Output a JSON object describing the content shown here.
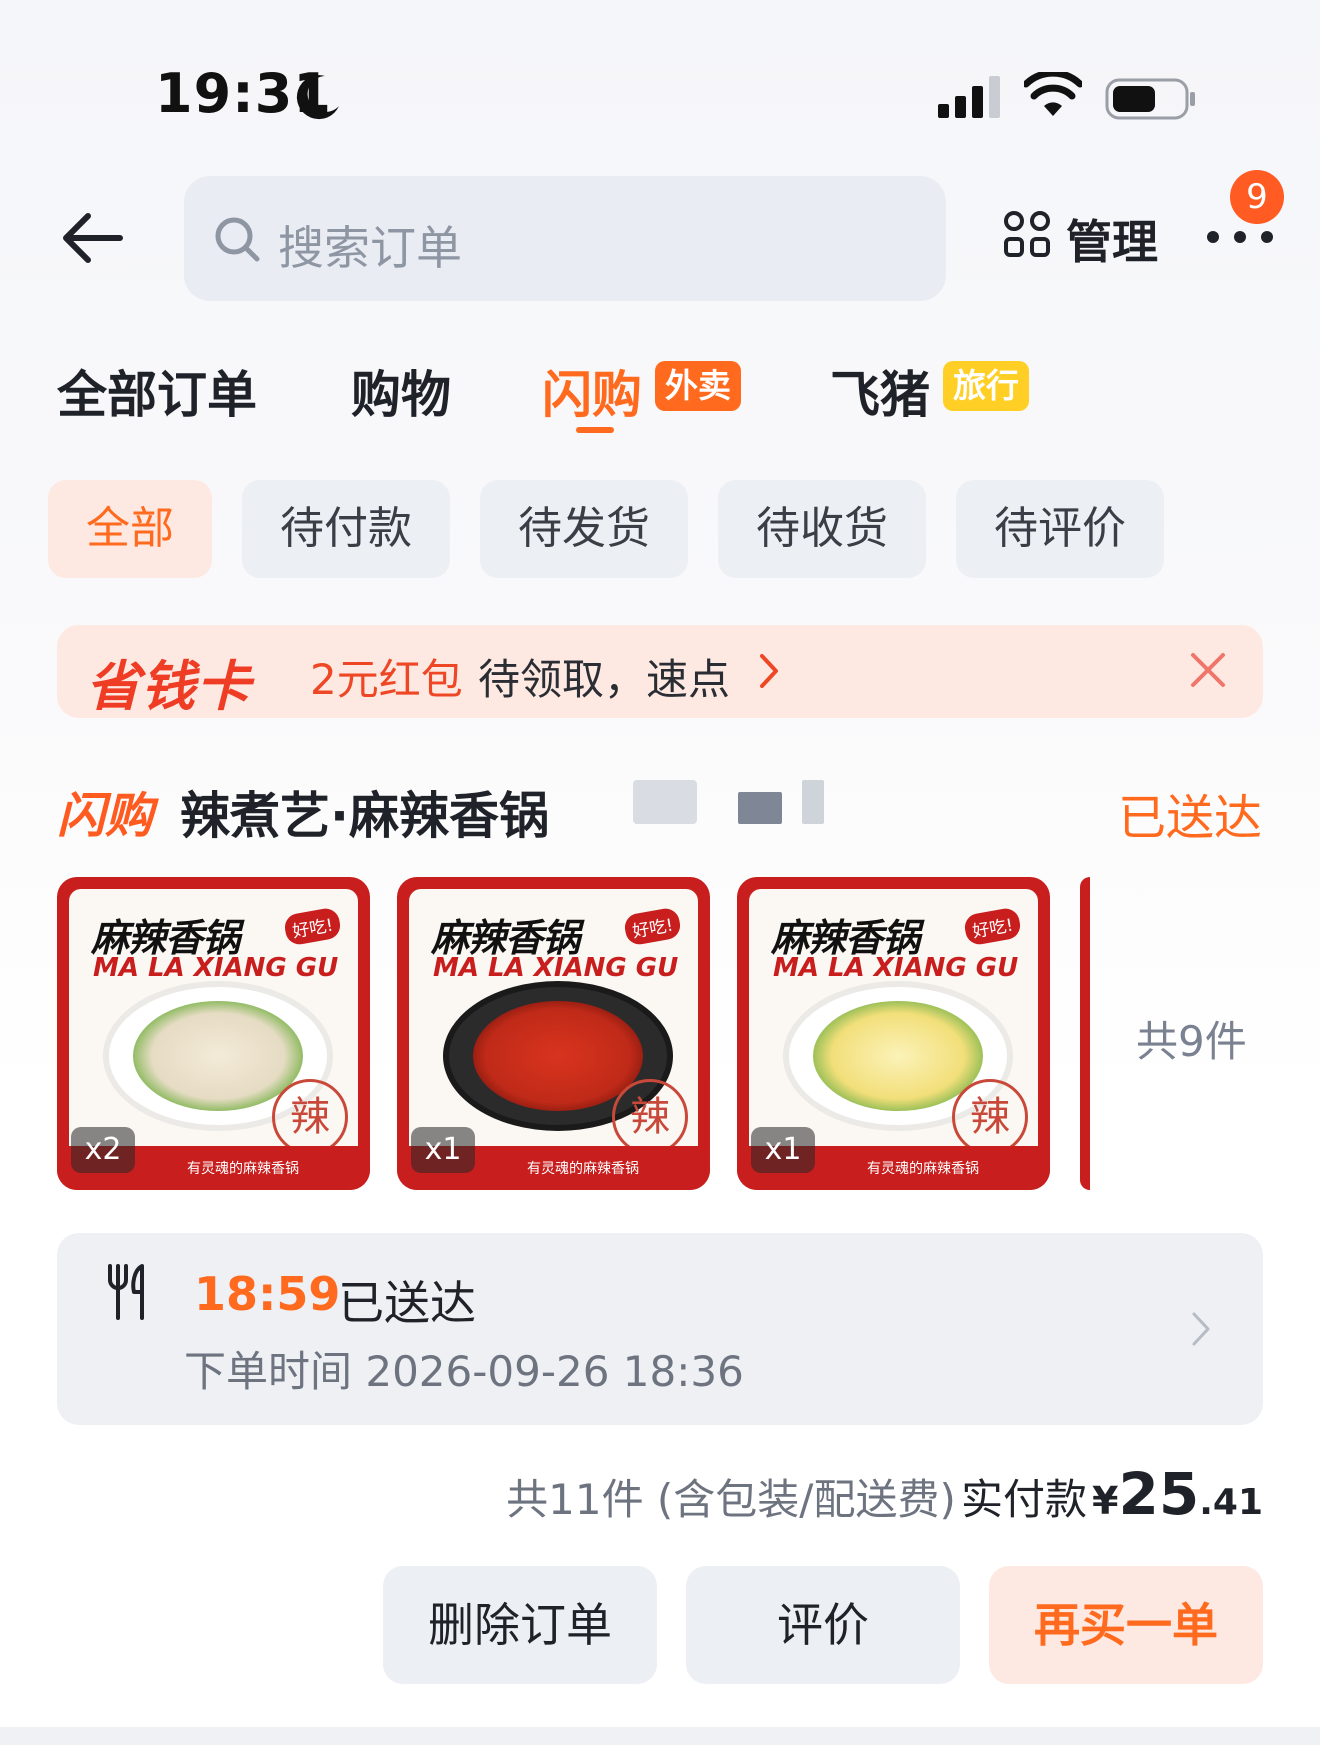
{
  "status_bar": {
    "time": "19:31",
    "icons": [
      "moon-icon",
      "signal-icon",
      "wifi-icon",
      "battery-icon"
    ]
  },
  "header": {
    "search_placeholder": "搜索订单",
    "manage_label": "管理",
    "more_badge": "9"
  },
  "tabs": [
    {
      "label": "全部订单",
      "tag": ""
    },
    {
      "label": "购物",
      "tag": ""
    },
    {
      "label": "闪购",
      "tag": "外卖",
      "active": true
    },
    {
      "label": "飞猪",
      "tag": "旅行"
    }
  ],
  "filters": [
    "全部",
    "待付款",
    "待发货",
    "待收货",
    "待评价"
  ],
  "promo": {
    "logo": "省钱卡",
    "highlight": "2元红包",
    "text": "待领取，速点"
  },
  "order": {
    "platform_logo": "闪购",
    "store_name": "辣煮艺·麻辣香锅",
    "status": "已送达",
    "products": [
      {
        "title": "麻辣香锅",
        "subtitle": "MA LA XIANG GU",
        "tag": "好吃!",
        "seal": "辣",
        "footer": "有灵魂的麻辣香锅",
        "qty": "x2",
        "food": "enoki-mushroom"
      },
      {
        "title": "麻辣香锅",
        "subtitle": "MA LA XIANG GU",
        "tag": "好吃!",
        "seal": "辣",
        "footer": "有灵魂的麻辣香锅",
        "qty": "x1",
        "food": "spicy-broth-pot"
      },
      {
        "title": "麻辣香锅",
        "subtitle": "MA LA XIANG GU",
        "tag": "好吃!",
        "seal": "辣",
        "footer": "有灵魂的麻辣香锅",
        "qty": "x1",
        "food": "napa-cabbage"
      }
    ],
    "items_count": "共9件",
    "delivery": {
      "time": "18:59",
      "status": "已送达",
      "order_time": "下单时间 2026-09-26 18:36"
    },
    "summary": {
      "items": "共11件 (含包装/配送费)",
      "paid_label": "实付款",
      "currency": "¥",
      "amount_int": "25",
      "amount_dec": ".41"
    },
    "actions": [
      "删除订单",
      "评价",
      "再买一单"
    ]
  },
  "colors": {
    "accent": "#ff6a1f",
    "promo_red": "#ee3c25",
    "product_red": "#c81e1e",
    "travel_tag": "#ffcf26"
  }
}
